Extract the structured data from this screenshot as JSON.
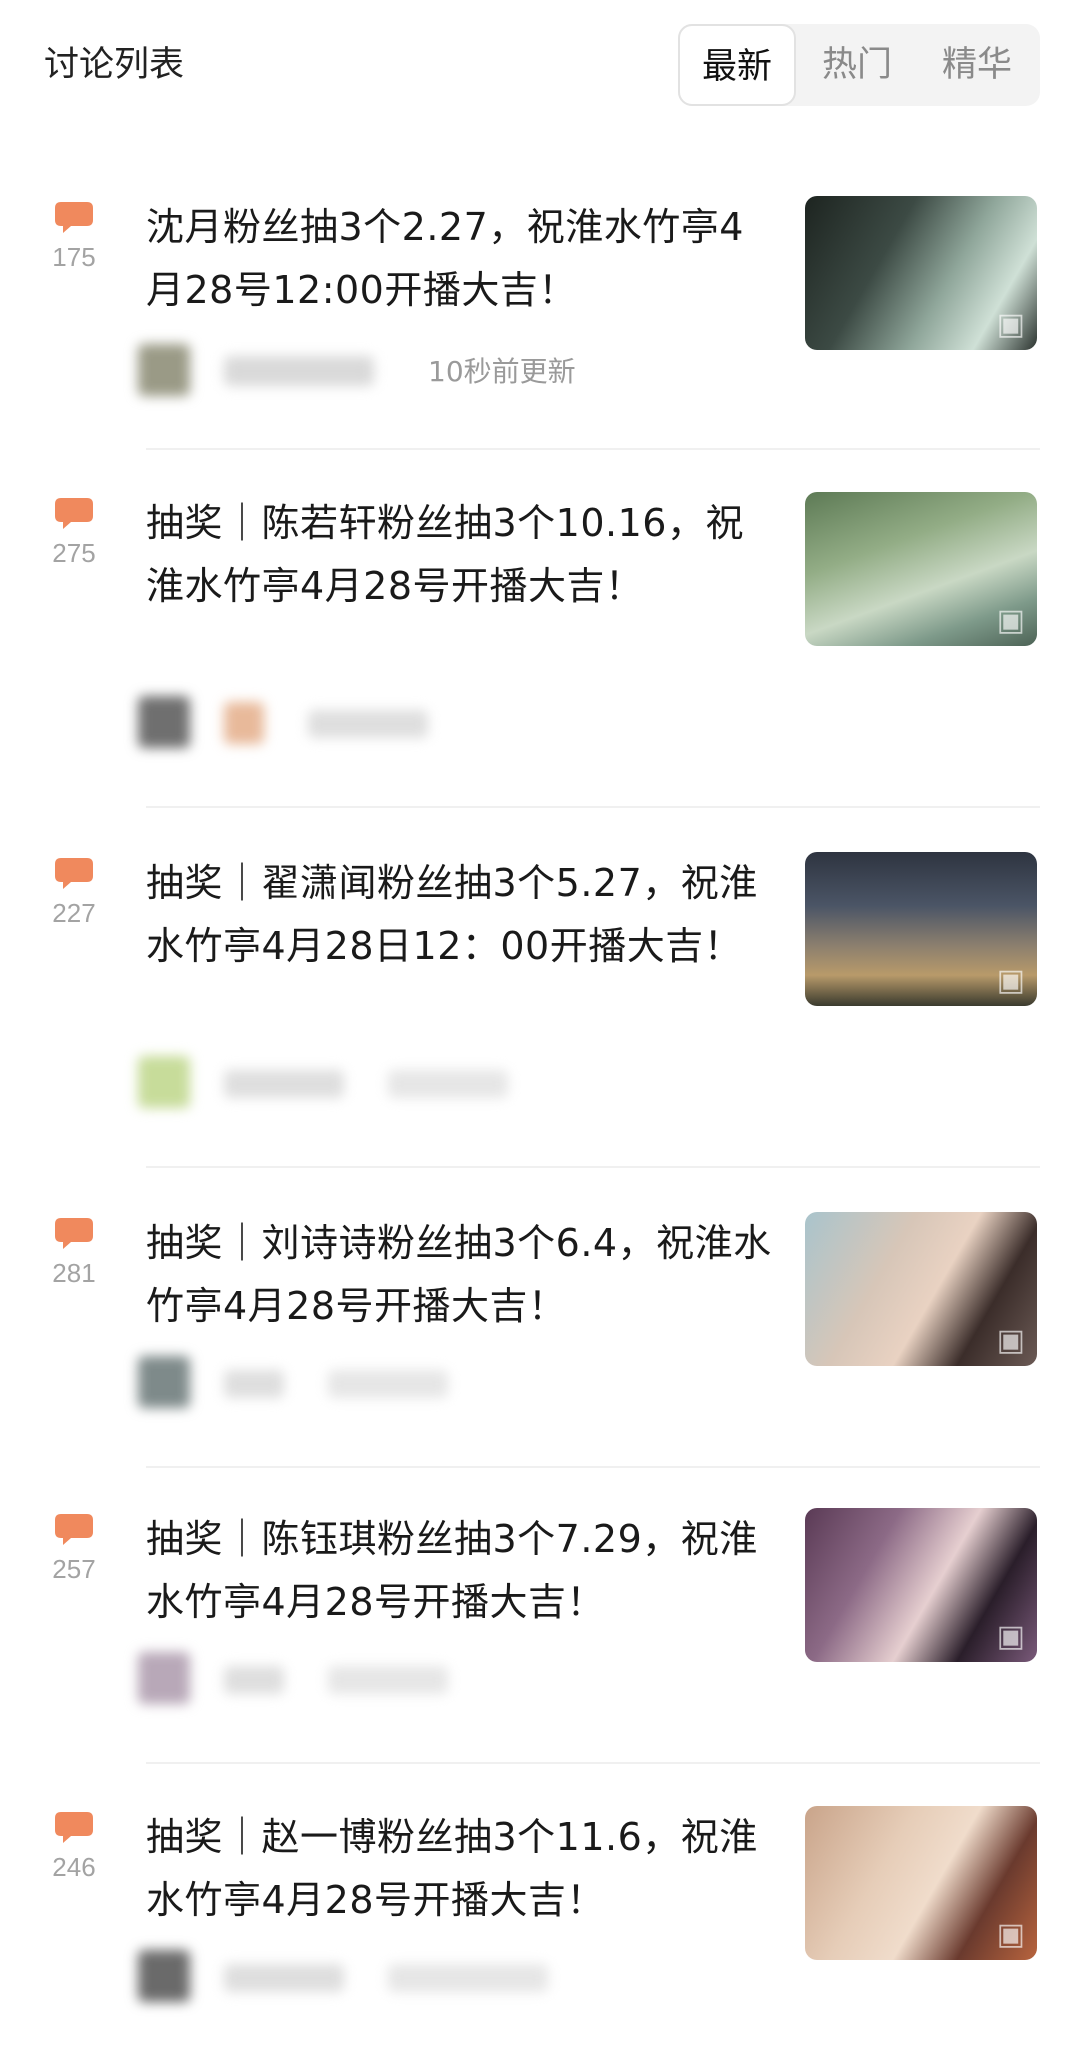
{
  "header": {
    "title": "讨论列表",
    "tabs": [
      {
        "label": "最新",
        "active": true
      },
      {
        "label": "热门",
        "active": false
      },
      {
        "label": "精华",
        "active": false
      }
    ]
  },
  "colors": {
    "accent": "#f0895d",
    "text": "#1a1a1a",
    "muted": "#9a9a9a"
  },
  "posts": [
    {
      "count": "175",
      "title": "沈月粉丝抽3个2.27，祝淮水竹亭4月28号12:00开播大吉！",
      "update_text": "10秒前更新",
      "thumb_icon": "image-icon"
    },
    {
      "count": "275",
      "title": "抽奖｜陈若轩粉丝抽3个10.16，祝淮水竹亭4月28号开播大吉！",
      "update_text": "",
      "thumb_icon": "image-icon"
    },
    {
      "count": "227",
      "title": "抽奖｜翟潇闻粉丝抽3个5.27，祝淮水竹亭4月28日12：00开播大吉！",
      "update_text": "",
      "thumb_icon": "image-icon"
    },
    {
      "count": "281",
      "title": "抽奖｜刘诗诗粉丝抽3个6.4，祝淮水竹亭4月28号开播大吉！",
      "update_text": "",
      "thumb_icon": "image-icon"
    },
    {
      "count": "257",
      "title": "抽奖｜陈钰琪粉丝抽3个7.29，祝淮水竹亭4月28号开播大吉！",
      "update_text": "",
      "thumb_icon": "image-icon"
    },
    {
      "count": "246",
      "title": "抽奖｜赵一博粉丝抽3个11.6，祝淮水竹亭4月28号开播大吉！",
      "update_text": "",
      "thumb_icon": "image-icon"
    }
  ]
}
